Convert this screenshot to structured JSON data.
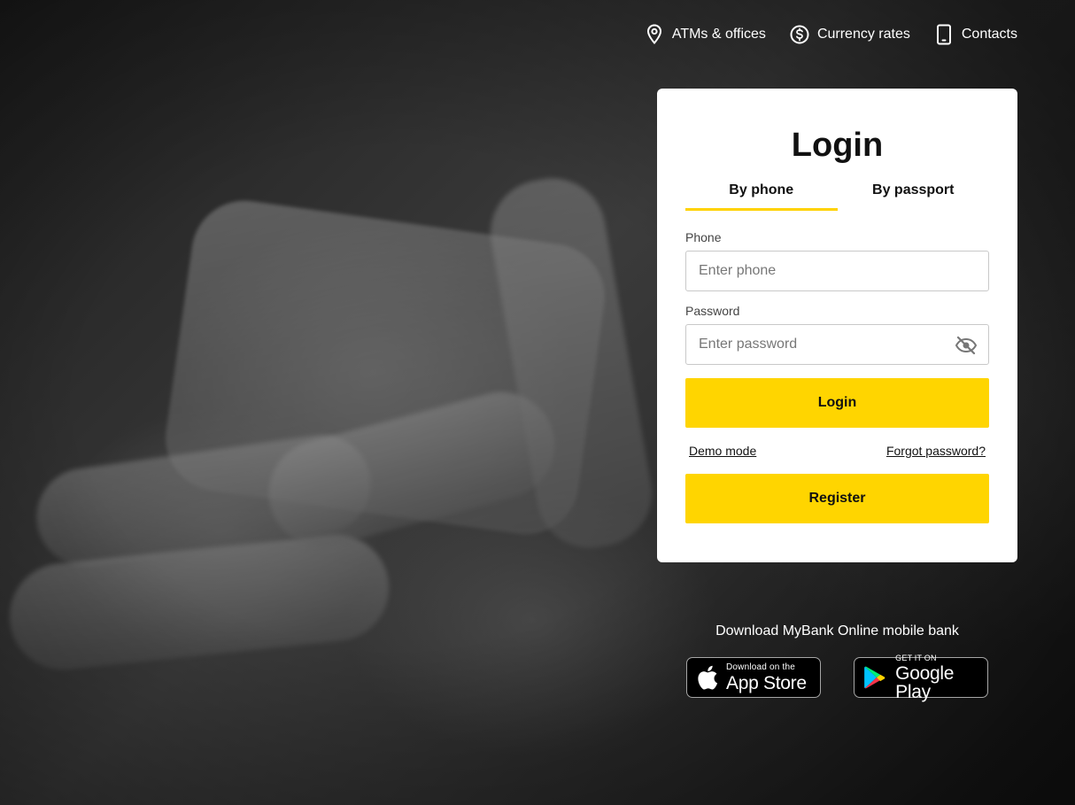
{
  "nav": {
    "atms_label": "ATMs & offices",
    "currency_label": "Currency rates",
    "contacts_label": "Contacts"
  },
  "login": {
    "title": "Login",
    "tabs": [
      "By phone",
      "By passport"
    ],
    "active_tab": "By phone",
    "phone_label": "Phone",
    "phone_placeholder": "Enter phone",
    "phone_value": "",
    "password_label": "Password",
    "password_placeholder": "Enter password",
    "password_value": "",
    "login_button": "Login",
    "demo_link": "Demo mode",
    "forgot_link": "Forgot password?",
    "register_button": "Register"
  },
  "download": {
    "text": "Download MyBank Online mobile bank",
    "appstore_small": "Download on the",
    "appstore_big": "App Store",
    "googleplay_small": "GET IT ON",
    "googleplay_big": "Google Play"
  },
  "colors": {
    "accent": "#ffd500",
    "card_bg": "#ffffff"
  },
  "icons": [
    "location-pin-icon",
    "dollar-circle-icon",
    "phone-icon",
    "eye-off-icon",
    "apple-icon",
    "google-play-icon"
  ]
}
